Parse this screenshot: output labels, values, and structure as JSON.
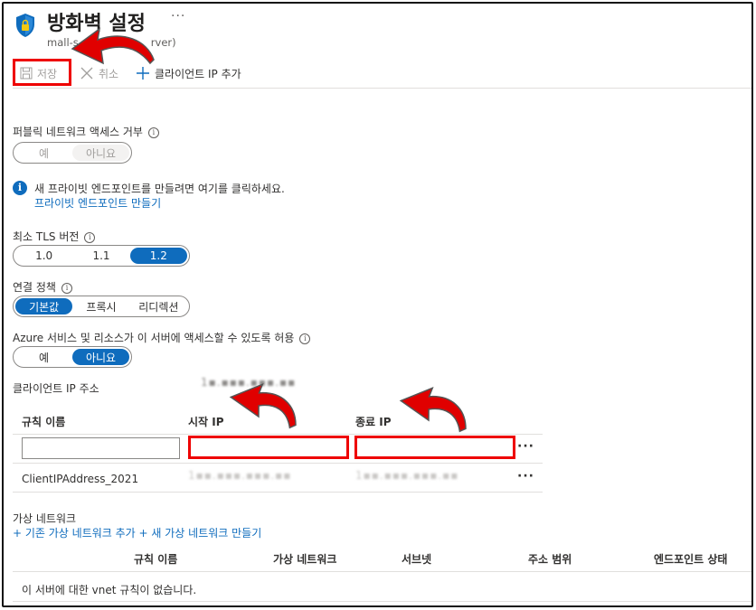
{
  "header": {
    "title": "방화벽 설정",
    "more": "···",
    "subtitle": "mall-s",
    "subtitle_tail": "rver)"
  },
  "toolbar": {
    "save_label": "저장",
    "cancel_label": "취소",
    "add_client_ip_label": "클라이언트 IP 추가"
  },
  "public_access": {
    "label": "퍼블릭 네트워크 액세스 거부",
    "options": [
      "예",
      "아니요"
    ],
    "selected": "아니요"
  },
  "private_endpoint": {
    "message": "새 프라이빗 엔드포인트를 만들려면 여기를 클릭하세요.",
    "link": "프라이빗 엔드포인트 만들기"
  },
  "tls": {
    "label": "최소 TLS 버전",
    "options": [
      "1.0",
      "1.1",
      "1.2"
    ],
    "selected": "1.2"
  },
  "connection_policy": {
    "label": "연결 정책",
    "options": [
      "기본값",
      "프록시",
      "리디렉션"
    ],
    "selected": "기본값"
  },
  "azure_services": {
    "label": "Azure 서비스 및 리소스가 이 서버에 액세스할 수 있도록 허용",
    "options": [
      "예",
      "아니요"
    ],
    "selected": "아니요"
  },
  "client_ip": {
    "label": "클라이언트 IP 주소",
    "value_blurred": "1▪.▪▪▪.▪▪▪.▪▪"
  },
  "ip_rules": {
    "columns": [
      "규칙 이름",
      "시작 IP",
      "종료 IP"
    ],
    "new_row": {
      "rule_name": "",
      "start_ip": "",
      "end_ip": ""
    },
    "rows": [
      {
        "rule_name": "ClientIPAddress_2021",
        "start_ip": "1▪▪.▪▪▪.▪▪▪.▪▪",
        "end_ip": "1▪▪.▪▪▪.▪▪▪.▪▪"
      }
    ],
    "more": "···"
  },
  "vnet": {
    "section_label": "가상 네트워크",
    "add_existing_link": "+ 기존 가상 네트워크 추가",
    "add_new_link": "+ 새 가상 네트워크 만들기",
    "columns": [
      "규칙 이름",
      "가상 네트워크",
      "서브넷",
      "주소 범위",
      "엔드포인트 상태"
    ],
    "empty_message": "이 서버에 대한 vnet 규칙이 없습니다."
  },
  "colors": {
    "accent": "#0f6cbd",
    "highlight": "#e00000"
  },
  "icons": [
    "shield-lock-icon",
    "save-icon",
    "close-icon",
    "plus-icon",
    "info-icon",
    "info-circle-icon",
    "more-icon",
    "curved-arrow-icon"
  ]
}
